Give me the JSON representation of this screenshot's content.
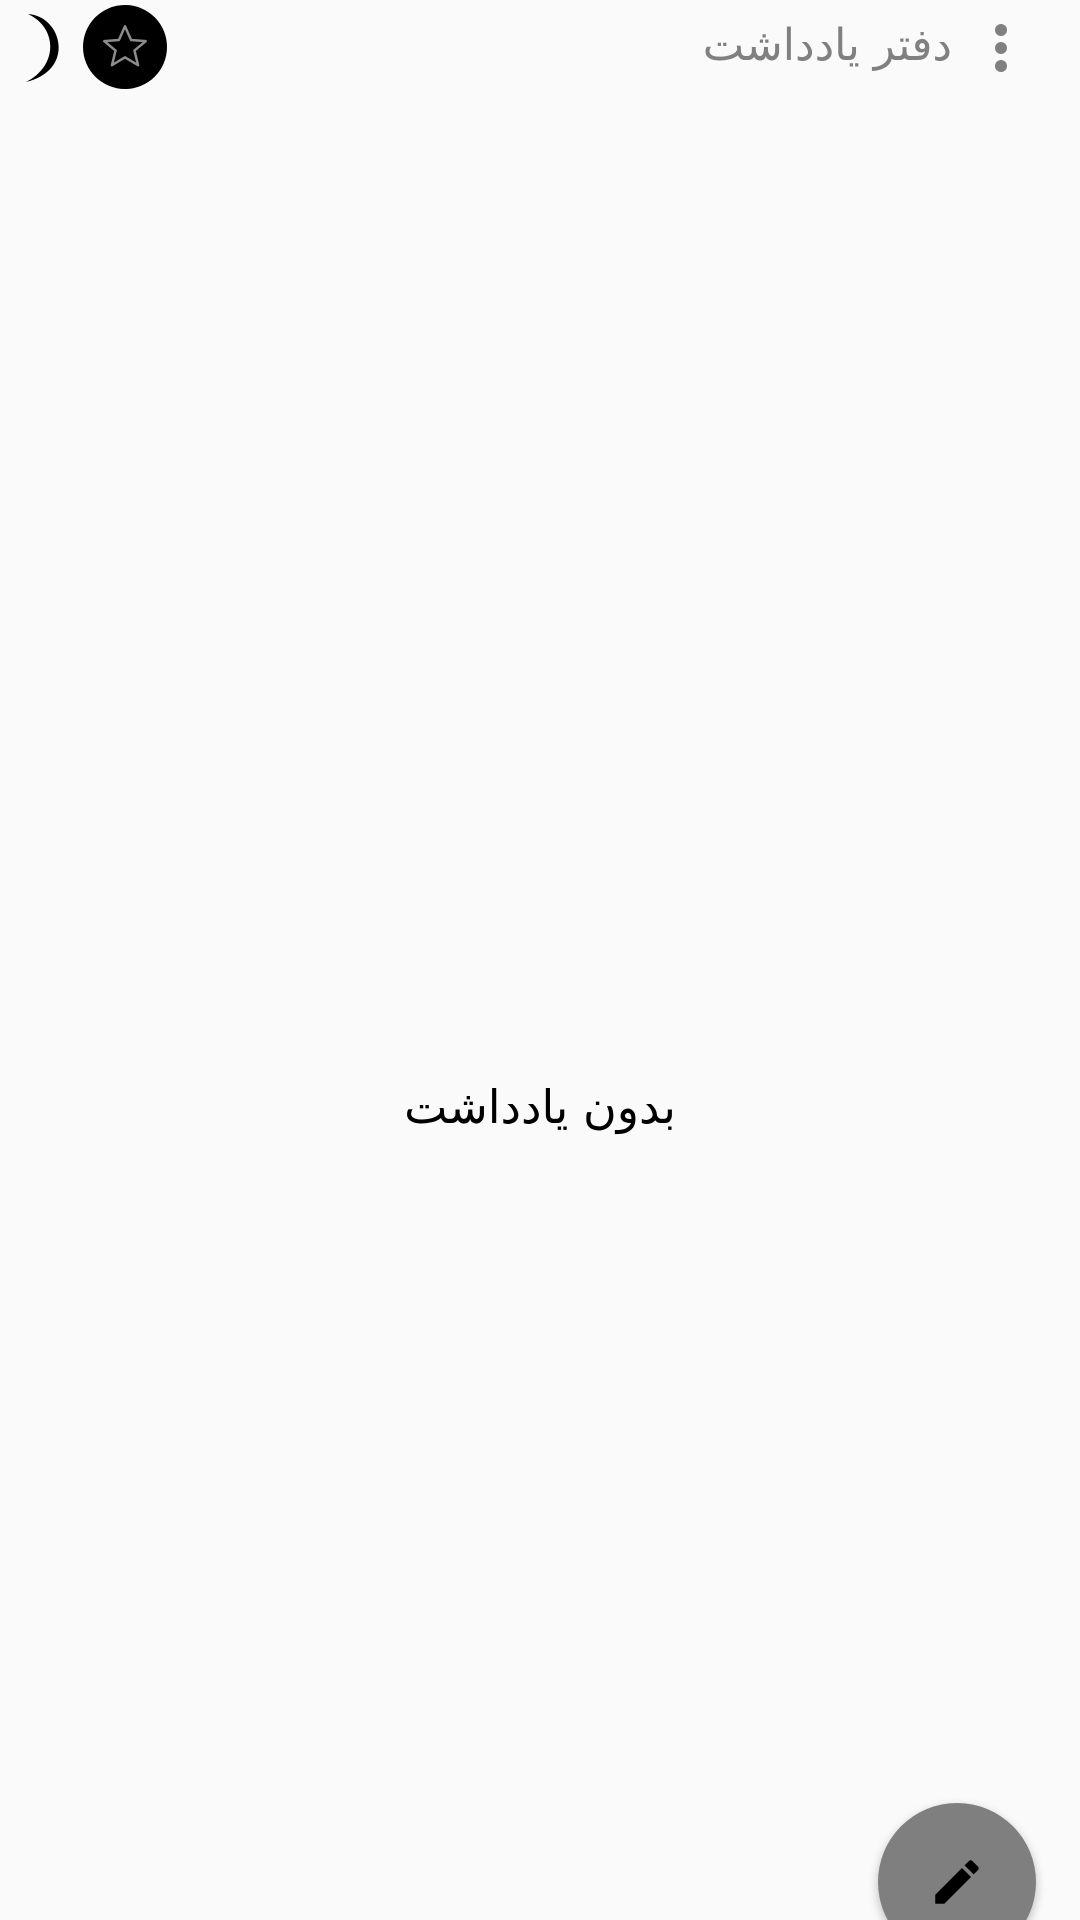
{
  "app_bar": {
    "title": "دفتر یادداشت",
    "title_color": "#808080",
    "left_icons": [
      "moon-icon",
      "star-icon"
    ],
    "right_icons": [
      "more-vertical-icon"
    ]
  },
  "main": {
    "empty_message": "بدون یادداشت"
  },
  "fab": {
    "icon": "pencil-icon",
    "color": "#7f7f7f"
  },
  "colors": {
    "background": "#fafafa",
    "icon_dark": "#000000",
    "icon_gray": "#808080"
  }
}
